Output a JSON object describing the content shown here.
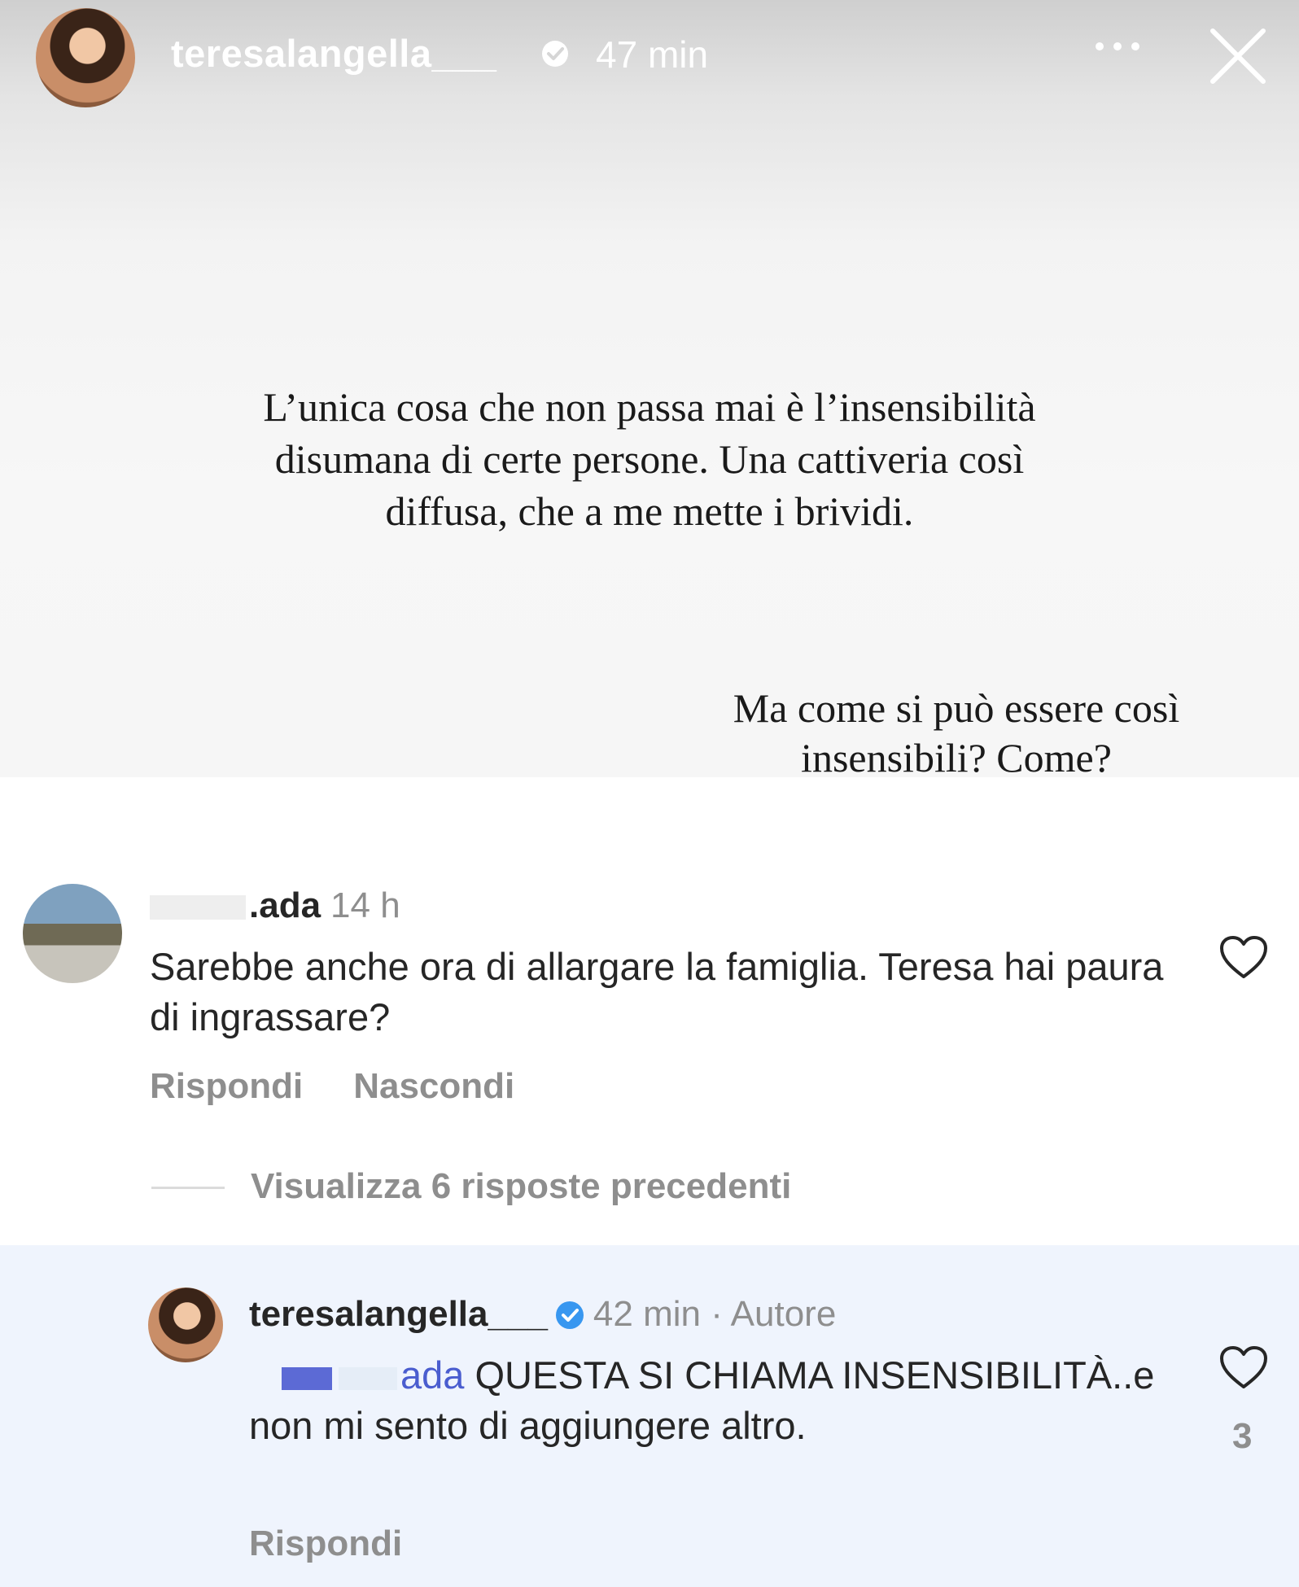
{
  "story": {
    "username": "teresalangella___",
    "time": "47 min",
    "quote": "L’unica cosa che non passa mai è l’insensibilità disumana di certe persone. Una cattiveria così diffusa, che a me mette i brividi.",
    "question": "Ma come si può essere così insensibili? Come?"
  },
  "comment": {
    "username_visible": ".ada",
    "time": "14 h",
    "text": "Sarebbe anche ora di allargare la famiglia. Teresa hai paura di ingrassare?",
    "actions": {
      "reply": "Rispondi",
      "hide": "Nascondi"
    }
  },
  "view_replies": "Visualizza 6 risposte precedenti",
  "reply": {
    "username": "teresalangella___",
    "meta": "42 min · Autore",
    "mention": "ada",
    "text": "QUESTA SI CHIAMA INSENSIBILITÀ..e non mi sento di aggiungere altro.",
    "action": "Rispondi",
    "likes": "3"
  },
  "colors": {
    "accent_blue": "#3897f0",
    "mention_blue": "#4a5dcf",
    "reply_highlight": "#eff4fd",
    "secondary_text": "#8e8e8e"
  }
}
